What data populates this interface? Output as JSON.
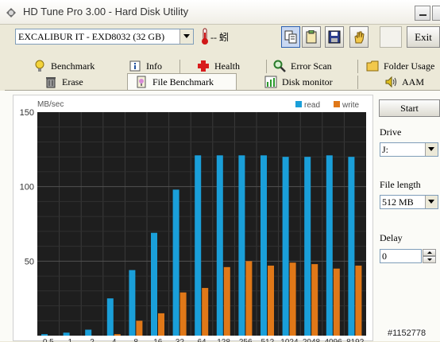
{
  "window": {
    "title": "HD Tune Pro 3.00 - Hard Disk Utility"
  },
  "toolbar": {
    "drive": "EXCALIBUR IT - EXD8032 (32 GB)",
    "temperature": "-- 蚓",
    "exit_label": "Exit"
  },
  "tabs_row1": [
    "Benchmark",
    "Info",
    "Health",
    "Error Scan",
    "Folder Usage"
  ],
  "tabs_row2": [
    "Erase",
    "File Benchmark",
    "Disk monitor",
    "AAM"
  ],
  "active_tab": "File Benchmark",
  "side": {
    "start_label": "Start",
    "drive_label": "Drive",
    "drive_value": "J:",
    "file_length_label": "File length",
    "file_length_value": "512 MB",
    "delay_label": "Delay",
    "delay_value": "0"
  },
  "watermark": "#1152778",
  "colors": {
    "read": "#1a9fd9",
    "write": "#e07818",
    "plot_bg": "#1e1e1e"
  },
  "chart_data": {
    "type": "bar",
    "ylabel": "MB/sec",
    "ylim": [
      0,
      150
    ],
    "yticks": [
      50,
      100,
      150
    ],
    "grid": true,
    "legend_position": "top-right",
    "categories": [
      "0.5",
      "1",
      "2",
      "4",
      "8",
      "16",
      "32",
      "64",
      "128",
      "256",
      "512",
      "1024",
      "2048",
      "4096",
      "8192"
    ],
    "series": [
      {
        "name": "read",
        "values": [
          1,
          2,
          4,
          25,
          44,
          69,
          98,
          121,
          121,
          121,
          121,
          120,
          120,
          121,
          120
        ]
      },
      {
        "name": "write",
        "values": [
          0,
          0,
          0,
          1,
          10,
          15,
          29,
          32,
          46,
          50,
          47,
          49,
          48,
          45,
          47
        ]
      }
    ]
  }
}
